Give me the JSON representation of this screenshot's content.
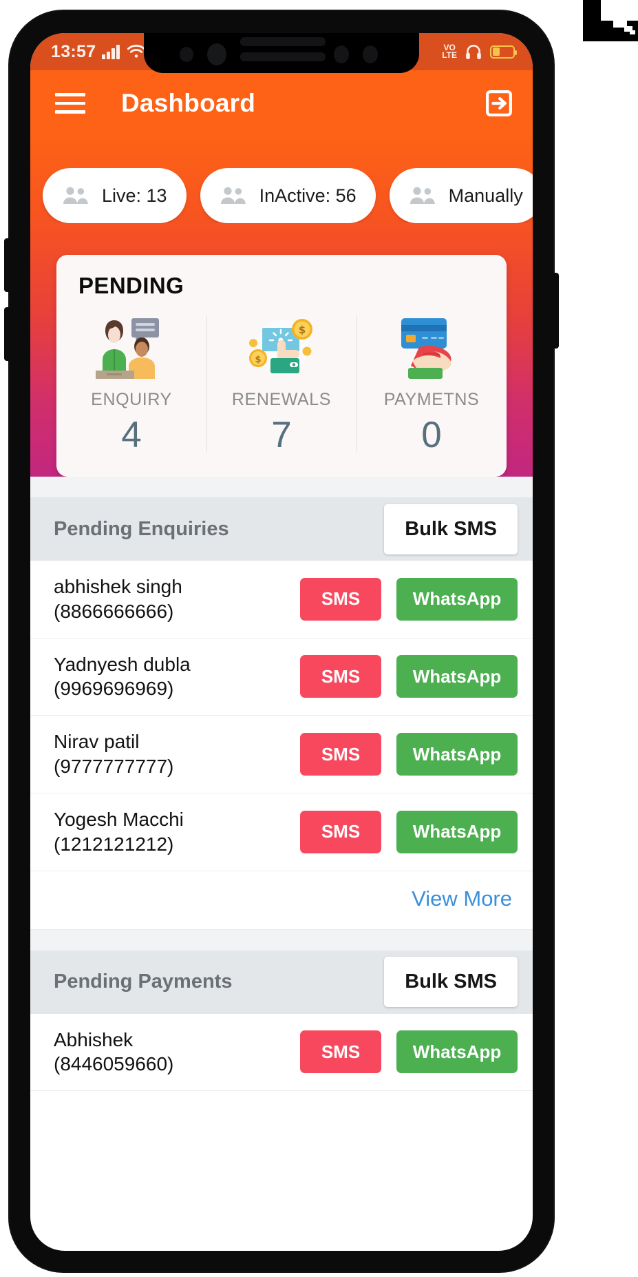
{
  "status_bar": {
    "clock": "13:57",
    "signal_icon": "signal-bars-icon",
    "wifi_icon": "wifi-icon",
    "volte_line1": "VO",
    "volte_line2": "LTE",
    "headphone_icon": "headphone-icon",
    "battery_icon": "battery-icon"
  },
  "app_bar": {
    "menu_icon": "hamburger-menu-icon",
    "title": "Dashboard",
    "logout_icon": "logout-icon"
  },
  "chips": [
    {
      "label": "Live: 13",
      "icon": "people-icon"
    },
    {
      "label": "InActive: 56",
      "icon": "people-icon"
    },
    {
      "label": "Manually",
      "icon": "people-icon"
    }
  ],
  "pending_card": {
    "title": "PENDING",
    "columns": [
      {
        "label": "ENQUIRY",
        "value": "4",
        "icon": "enquiry-illustration"
      },
      {
        "label": "RENEWALS",
        "value": "7",
        "icon": "renewals-illustration"
      },
      {
        "label": "PAYMETNS",
        "value": "0",
        "icon": "payments-illustration"
      }
    ]
  },
  "enquiries_section": {
    "title": "Pending Enquiries",
    "bulk_sms_label": "Bulk SMS",
    "view_more_label": "View More",
    "rows": [
      {
        "name": "abhishek singh",
        "phone": "(8866666666)",
        "sms_label": "SMS",
        "whatsapp_label": "WhatsApp"
      },
      {
        "name": "Yadnyesh dubla",
        "phone": "(9969696969)",
        "sms_label": "SMS",
        "whatsapp_label": "WhatsApp"
      },
      {
        "name": "Nirav patil",
        "phone": "(9777777777)",
        "sms_label": "SMS",
        "whatsapp_label": "WhatsApp"
      },
      {
        "name": "Yogesh Macchi",
        "phone": "(1212121212)",
        "sms_label": "SMS",
        "whatsapp_label": "WhatsApp"
      }
    ]
  },
  "payments_section": {
    "title": "Pending Payments",
    "bulk_sms_label": "Bulk SMS",
    "rows": [
      {
        "name": "Abhishek",
        "phone": "(8446059660)",
        "sms_label": "SMS",
        "whatsapp_label": "WhatsApp"
      }
    ]
  },
  "colors": {
    "brand_orange": "#fd6216",
    "status_bar_orange": "#d94f1e",
    "gradient_end_magenta": "#c2277f",
    "sms_red": "#f8485e",
    "whatsapp_green": "#4caf50",
    "link_blue": "#3a8fdc",
    "stat_number": "#56707c",
    "section_band": "#e4e7ea"
  }
}
